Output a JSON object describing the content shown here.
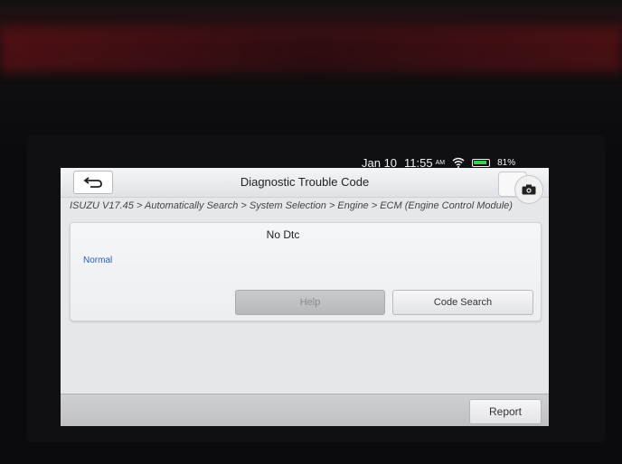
{
  "status_bar": {
    "date": "Jan 10",
    "time": "11:55",
    "ampm": "AM",
    "battery": "81%"
  },
  "header": {
    "title": "Diagnostic Trouble Code"
  },
  "breadcrumb": "ISUZU V17.45 > Automatically Search > System Selection > Engine > ECM (Engine Control Module)",
  "dtc_panel": {
    "message": "No Dtc",
    "status": "Normal",
    "help_label": "Help",
    "code_search_label": "Code Search"
  },
  "footer": {
    "report_label": "Report"
  },
  "colors": {
    "status_text": "#2a5bb8",
    "battery_fill": "#3ad04a"
  },
  "icons": [
    "back-arrow-icon",
    "wifi-icon",
    "battery-icon",
    "camera-icon"
  ]
}
